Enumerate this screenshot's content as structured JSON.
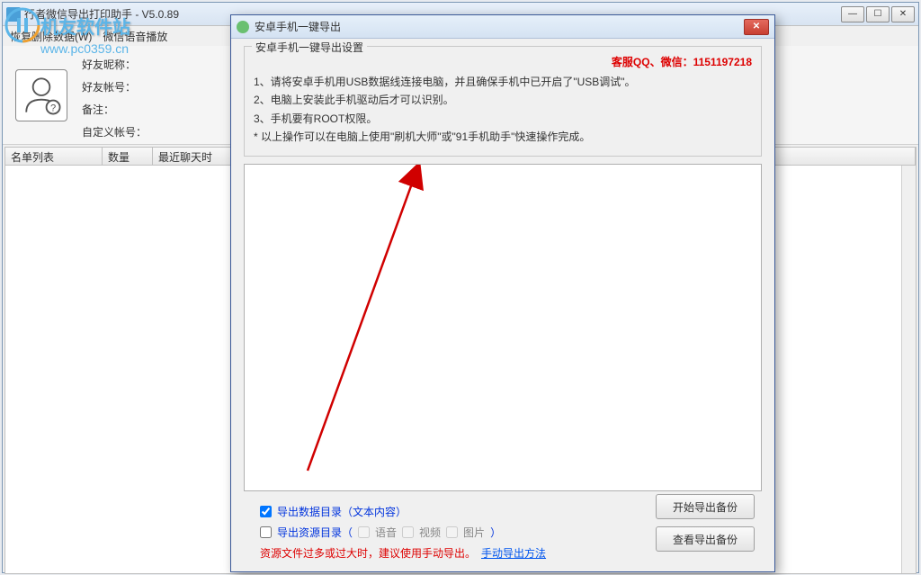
{
  "watermark": {
    "site_name": "机友软件站",
    "url": "www.pc0359.cn"
  },
  "main_window": {
    "title": "行者微信导出打印助手 - V5.0.89",
    "menu": {
      "item1": "恢复删除数据(W)",
      "item2": "微信语音播放"
    },
    "info": {
      "nickname_label": "好友昵称：",
      "account_label": "好友帐号：",
      "remark_label": "备注：",
      "custom_label": "自定义帐号："
    },
    "table": {
      "col1": "名单列表",
      "col2": "数量",
      "col3": "最近聊天时"
    },
    "window_buttons": {
      "min": "—",
      "max": "☐",
      "close": "✕"
    }
  },
  "dialog": {
    "title": "安卓手机一键导出",
    "group_title": "安卓手机一键导出设置",
    "contact": "客服QQ、微信：1151197218",
    "instr_1": "1、请将安卓手机用USB数据线连接电脑，并且确保手机中已开启了\"USB调试\"。",
    "instr_2": "2、电脑上安装此手机驱动后才可以识别。",
    "instr_3": "3、手机要有ROOT权限。",
    "instr_4": "* 以上操作可以在电脑上使用\"刷机大师\"或\"91手机助手\"快速操作完成。",
    "options": {
      "data_dir": "导出数据目录（文本内容）",
      "resource_dir": "导出资源目录（",
      "audio": "语音",
      "video": "视频",
      "image": "图片",
      "close_paren": "）"
    },
    "warning": "资源文件过多或过大时，建议使用手动导出。",
    "manual_link": "手动导出方法",
    "buttons": {
      "start": "开始导出备份",
      "view": "查看导出备份"
    }
  }
}
